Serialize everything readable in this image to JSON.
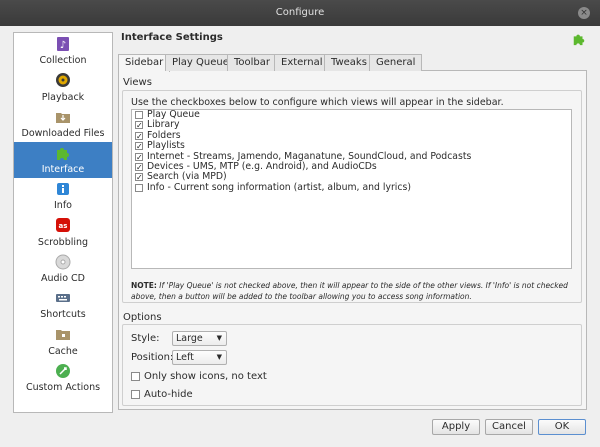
{
  "window": {
    "title": "Configure",
    "close_glyph": "×"
  },
  "sidebar": {
    "items": [
      {
        "label": "Collection",
        "icon": "collection-icon"
      },
      {
        "label": "Playback",
        "icon": "playback-icon"
      },
      {
        "label": "Downloaded Files",
        "icon": "downloaded-files-icon"
      },
      {
        "label": "Interface",
        "icon": "puzzle-icon",
        "active": true
      },
      {
        "label": "Info",
        "icon": "info-icon"
      },
      {
        "label": "Scrobbling",
        "icon": "lastfm-icon"
      },
      {
        "label": "Audio CD",
        "icon": "cd-icon"
      },
      {
        "label": "Shortcuts",
        "icon": "keyboard-icon"
      },
      {
        "label": "Cache",
        "icon": "cache-folder-icon"
      },
      {
        "label": "Custom Actions",
        "icon": "custom-actions-icon"
      }
    ]
  },
  "content": {
    "title": "Interface Settings",
    "tabs": [
      {
        "label": "Sidebar",
        "active": true
      },
      {
        "label": "Play Queue"
      },
      {
        "label": "Toolbar"
      },
      {
        "label": "External"
      },
      {
        "label": "Tweaks"
      },
      {
        "label": "General"
      }
    ],
    "views": {
      "group_title": "Views",
      "description": "Use the checkboxes below to configure which views will appear in the sidebar.",
      "items": [
        {
          "label": "Play Queue",
          "checked": false
        },
        {
          "label": "Library",
          "checked": true
        },
        {
          "label": "Folders",
          "checked": true
        },
        {
          "label": "Playlists",
          "checked": true
        },
        {
          "label": "Internet - Streams, Jamendo, Maganatune, SoundCloud, and Podcasts",
          "checked": true
        },
        {
          "label": "Devices - UMS, MTP (e.g. Android), and AudioCDs",
          "checked": true
        },
        {
          "label": "Search (via MPD)",
          "checked": true
        },
        {
          "label": "Info - Current song information (artist, album, and lyrics)",
          "checked": false
        }
      ],
      "note_prefix": "NOTE:",
      "note": " If 'Play Queue' is not checked above, then it will appear to the side of the other views. If 'Info' is not checked above, then a button will be added to the toolbar allowing you to access song information."
    },
    "options": {
      "group_title": "Options",
      "style_label": "Style:",
      "style_value": "Large",
      "position_label": "Position:",
      "position_value": "Left",
      "only_icons_label": "Only show icons, no text",
      "only_icons_checked": false,
      "autohide_label": "Auto-hide",
      "autohide_checked": false
    }
  },
  "buttons": {
    "apply": "Apply",
    "cancel": "Cancel",
    "ok": "OK"
  },
  "colors": {
    "accent": "#3d7fc4",
    "titlebar": "#3c3c3c"
  },
  "check_glyph": "✓",
  "combo_arrow": "▼"
}
